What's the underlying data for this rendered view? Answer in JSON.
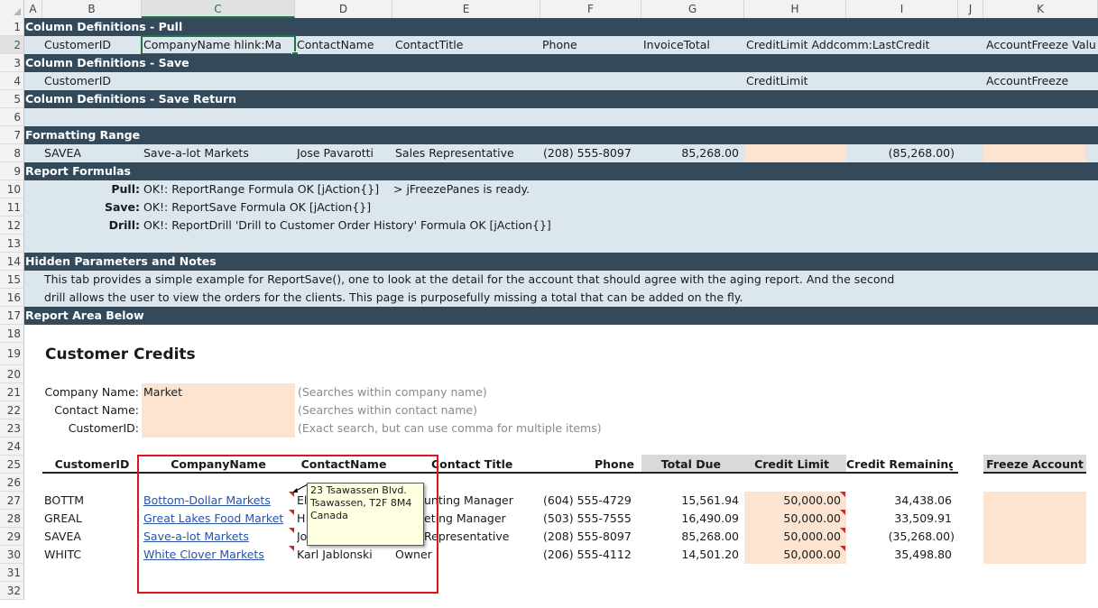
{
  "columns": [
    "A",
    "B",
    "C",
    "D",
    "E",
    "F",
    "G",
    "H",
    "I",
    "J",
    "K"
  ],
  "rows": [
    "1",
    "2",
    "3",
    "4",
    "5",
    "6",
    "7",
    "8",
    "9",
    "10",
    "11",
    "12",
    "13",
    "14",
    "15",
    "16",
    "17",
    "18",
    "19",
    "20",
    "21",
    "22",
    "23",
    "24",
    "25",
    "26",
    "27",
    "28",
    "29",
    "30",
    "31",
    "32"
  ],
  "bands": {
    "pull": "Column Definitions - Pull",
    "save": "Column Definitions - Save",
    "save_return": "Column Definitions - Save Return",
    "formatting": "Formatting Range",
    "formulas": "Report Formulas",
    "hidden": "Hidden Parameters and Notes",
    "report_area": "Report Area Below"
  },
  "pull_row": {
    "b": "CustomerID",
    "c": "CompanyName hlink:Ma",
    "d": "ContactName",
    "e": "ContactTitle",
    "f": "Phone",
    "g": "InvoiceTotal",
    "h": "CreditLimit Addcomm:LastCredit",
    "k": "AccountFreeze Valu"
  },
  "save_row": {
    "b": "CustomerID",
    "h": "CreditLimit",
    "k": "AccountFreeze"
  },
  "format_row": {
    "b": "SAVEA",
    "c": "Save-a-lot Markets",
    "d": "Jose Pavarotti",
    "e": "Sales Representative",
    "f": "(208) 555-8097",
    "g": "85,268.00",
    "i": "(85,268.00)"
  },
  "formulas": {
    "pull_label": "Pull:",
    "pull_text": "OK!: ReportRange Formula OK [jAction{}]",
    "pull_extra": "> jFreezePanes is ready.",
    "save_label": "Save:",
    "save_text": "OK!: ReportSave Formula OK [jAction{}]",
    "drill_label": "Drill:",
    "drill_text": "OK!: ReportDrill 'Drill to Customer Order History' Formula OK [jAction{}]"
  },
  "notes": {
    "line1": "This tab provides a simple example for ReportSave(), one to look at the detail for the account that should agree with the aging report. And the second",
    "line2": "drill allows the user to view the orders for the clients.   This page is purposefully missing a total that can be added on the fly."
  },
  "report": {
    "title": "Customer Credits",
    "filters": {
      "company_label": "Company Name:",
      "company_value": "Market",
      "company_hint": "(Searches within company name)",
      "contact_label": "Contact Name:",
      "contact_value": "",
      "contact_hint": "(Searches within contact name)",
      "customer_label": "CustomerID:",
      "customer_value": "",
      "customer_hint": "(Exact search, but can use comma for multiple items)"
    },
    "headers": {
      "customer_id": "CustomerID",
      "company": "CompanyName",
      "contact": "ContactName",
      "title": "Contact Title",
      "phone": "Phone",
      "total_due": "Total Due",
      "credit_limit": "Credit Limit",
      "credit_remaining": "Credit Remaining",
      "freeze": "Freeze Account"
    },
    "rows": [
      {
        "id": "BOTTM",
        "company": "Bottom-Dollar Markets",
        "contact": "El",
        "title": "unting Manager",
        "phone": "(604) 555-4729",
        "total": "15,561.94",
        "limit": "50,000.00",
        "remaining": "34,438.06"
      },
      {
        "id": "GREAL",
        "company": "Great Lakes Food Market",
        "contact": "H",
        "title": "eting Manager",
        "phone": "(503) 555-7555",
        "total": "16,490.09",
        "limit": "50,000.00",
        "remaining": "33,509.91"
      },
      {
        "id": "SAVEA",
        "company": "Save-a-lot Markets",
        "contact": "Jo",
        "title": "Representative",
        "phone": "(208) 555-8097",
        "total": "85,268.00",
        "limit": "50,000.00",
        "remaining": "(35,268.00)"
      },
      {
        "id": "WHITC",
        "company": "White Clover Markets",
        "contact": "Karl Jablonski",
        "title": "Owner",
        "phone": "(206) 555-4112",
        "total": "14,501.20",
        "limit": "50,000.00",
        "remaining": "35,498.80"
      }
    ],
    "comment": {
      "line1": "23 Tsawassen Blvd.",
      "line2": "Tsawassen, T2F 8M4",
      "line3": "Canada"
    }
  },
  "colors": {
    "band_dark": "#344a5a",
    "band_light": "#dce6ed",
    "input_fill": "#fce4d0",
    "highlight_box": "#e0141e",
    "selection": "#217346"
  }
}
